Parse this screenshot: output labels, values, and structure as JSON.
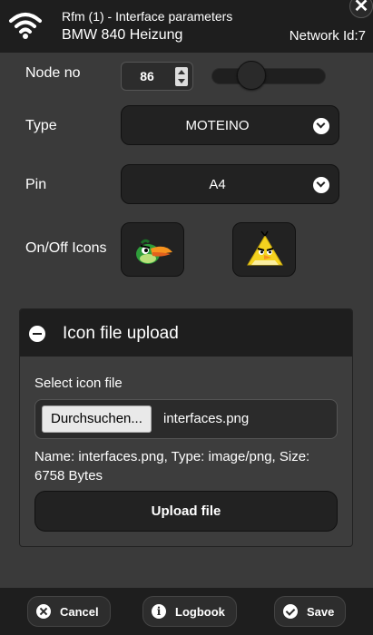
{
  "header": {
    "title": "Rfm (1) - Interface parameters",
    "subtitle": "BMW 840 Heizung",
    "network": "Network Id:7",
    "close_icon": "close-icon",
    "wifi_icon": "wifi-icon"
  },
  "form": {
    "node": {
      "label": "Node no",
      "value": "86",
      "slider_level": 0.3
    },
    "type": {
      "label": "Type",
      "value": "MOTEINO"
    },
    "pin": {
      "label": "Pin",
      "value": "A4"
    },
    "icons": {
      "label": "On/Off Icons",
      "on_icon": "green-bird-icon",
      "off_icon": "yellow-bird-icon"
    }
  },
  "upload_panel": {
    "title": "Icon file upload",
    "select_label": "Select icon file",
    "browse_label": "Durchsuchen...",
    "file_name": "interfaces.png",
    "info": "Name: interfaces.png, Type: image/png, Size: 6758 Bytes",
    "upload_label": "Upload file"
  },
  "footer": {
    "cancel_label": "Cancel",
    "logbook_label": "Logbook",
    "save_label": "Save"
  }
}
